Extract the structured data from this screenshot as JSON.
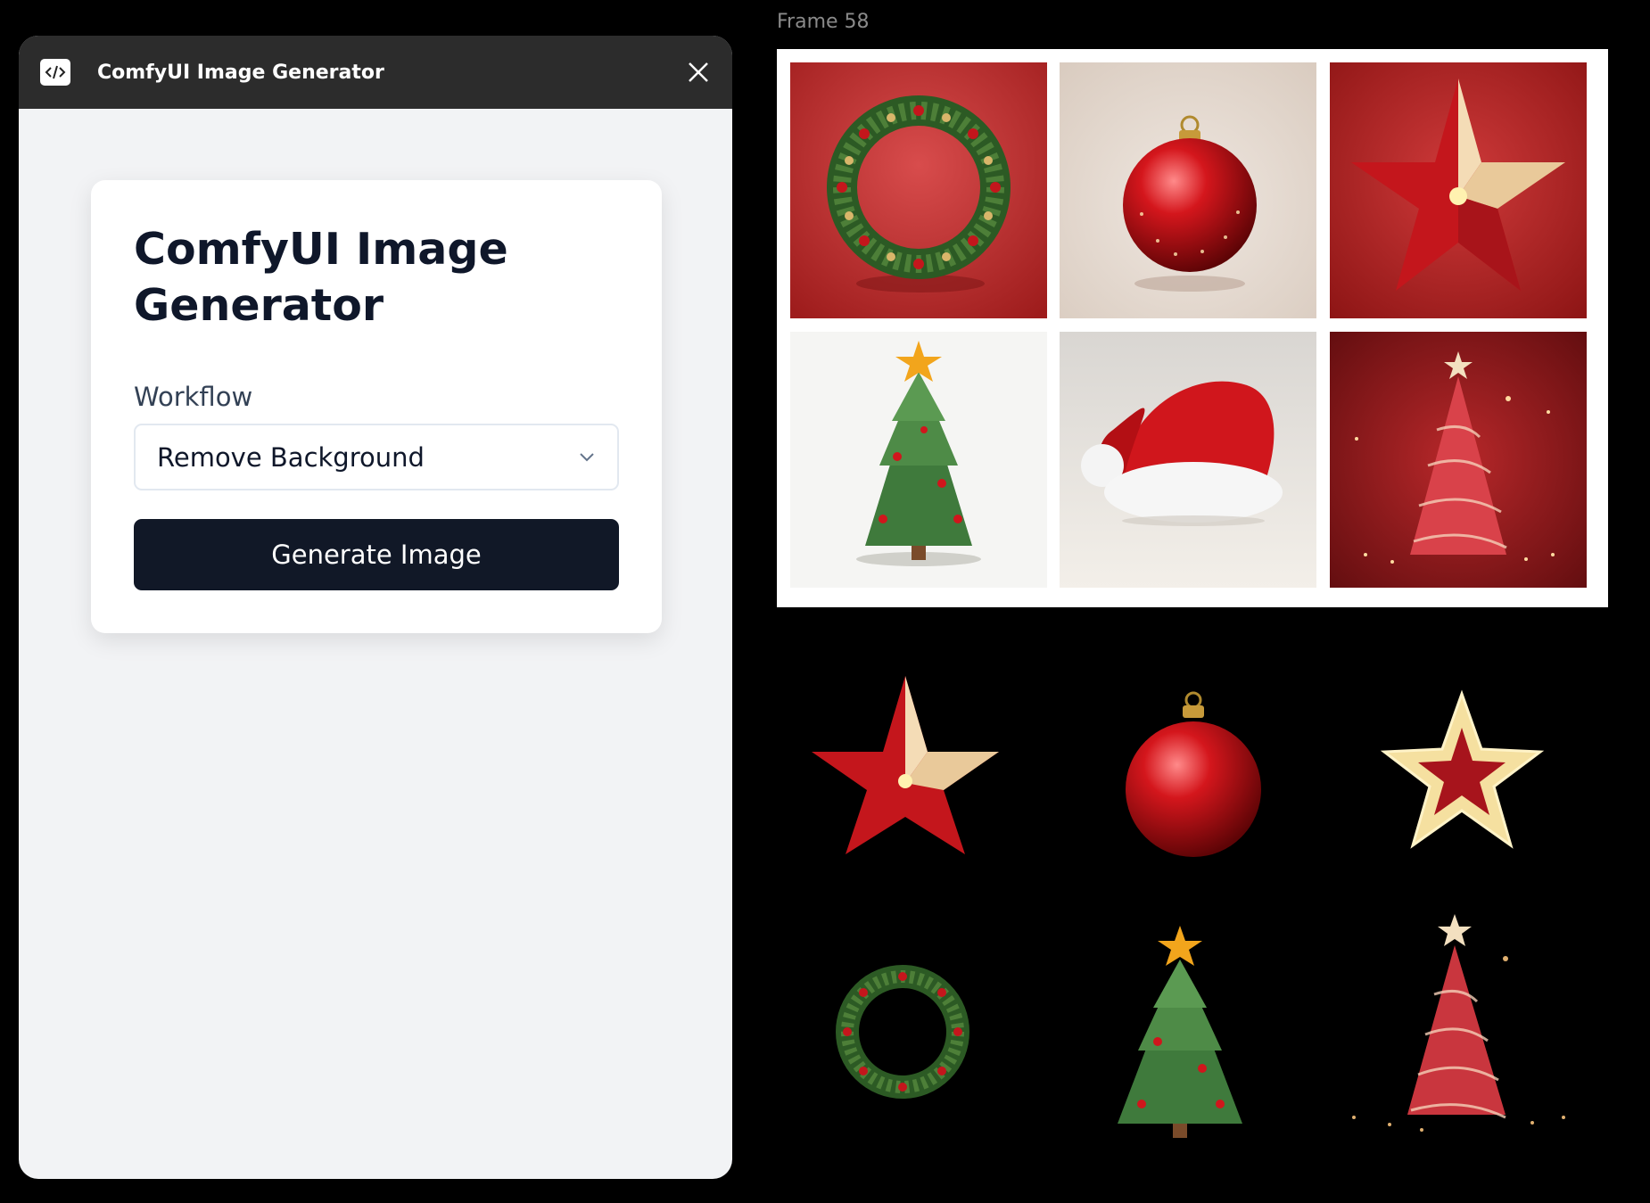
{
  "plugin": {
    "window_title": "ComfyUI Image Generator",
    "heading": "ComfyUI Image Generator",
    "workflow_label": "Workflow",
    "workflow_selected": "Remove Background",
    "generate_label": "Generate Image"
  },
  "canvas": {
    "frame_label": "Frame 58",
    "frame_images": [
      "wreath",
      "red-ornament",
      "red-star",
      "green-christmas-tree",
      "santa-hat",
      "sparkling-red-tree"
    ],
    "cutout_images": [
      "red-star",
      "red-ornament",
      "gold-outline-star",
      "wreath",
      "green-christmas-tree",
      "sparkling-red-tree"
    ]
  },
  "colors": {
    "titlebar": "#2c2c2c",
    "panel_bg": "#f2f3f5",
    "button": "#111827",
    "canvas_bg": "#000000"
  }
}
